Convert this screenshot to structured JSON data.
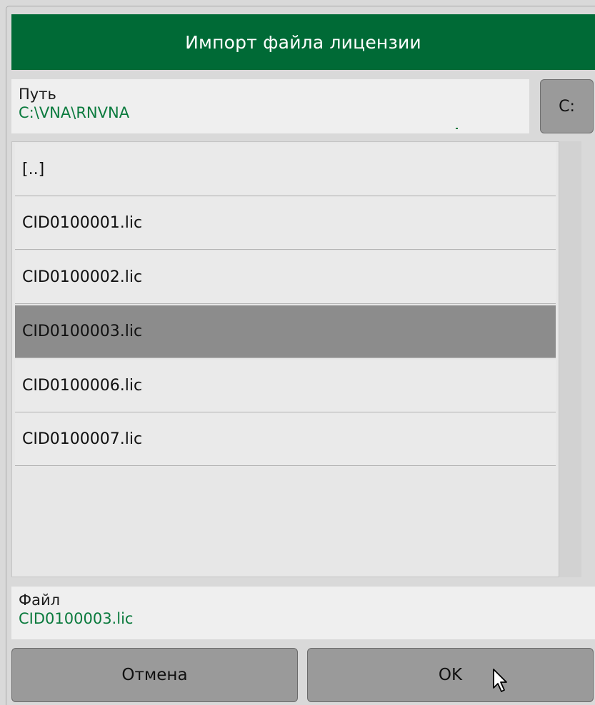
{
  "dialog": {
    "title": "Импорт файла лицензии",
    "path": {
      "label": "Путь",
      "value": "C:\\VNA\\RNVNA"
    },
    "drive_button": "C:",
    "files": [
      "[..]",
      "CID0100001.lic",
      "CID0100002.lic",
      "CID0100003.lic",
      "CID0100006.lic",
      "CID0100007.lic"
    ],
    "selected_file": "CID0100003.lic",
    "file": {
      "label": "Файл",
      "value": "CID0100003.lic"
    },
    "cancel_button": "Отмена",
    "ok_button": "OK"
  },
  "colors": {
    "title_bg": "#006a36",
    "path_value": "#0a7a3d",
    "selected_row": "#8c8c8c"
  },
  "icons": [
    "mouse-pointer-icon"
  ]
}
